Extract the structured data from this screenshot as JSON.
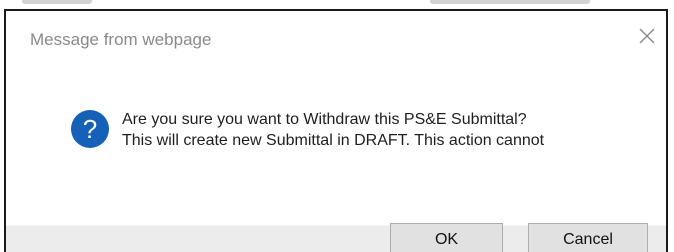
{
  "dialog": {
    "title": "Message from webpage",
    "message_lines": [
      "Are you sure you want to Withdraw this PS&E Submittal?",
      "This will create new Submittal in DRAFT. This action cannot"
    ],
    "icon": "question-icon",
    "close_icon": "close-icon",
    "buttons": {
      "ok_label": "OK",
      "cancel_label": "Cancel"
    }
  },
  "colors": {
    "icon_blue": "#1561b8",
    "title_text": "#8a8a8a",
    "button_face": "#e1e1e1",
    "button_border": "#adadad"
  }
}
